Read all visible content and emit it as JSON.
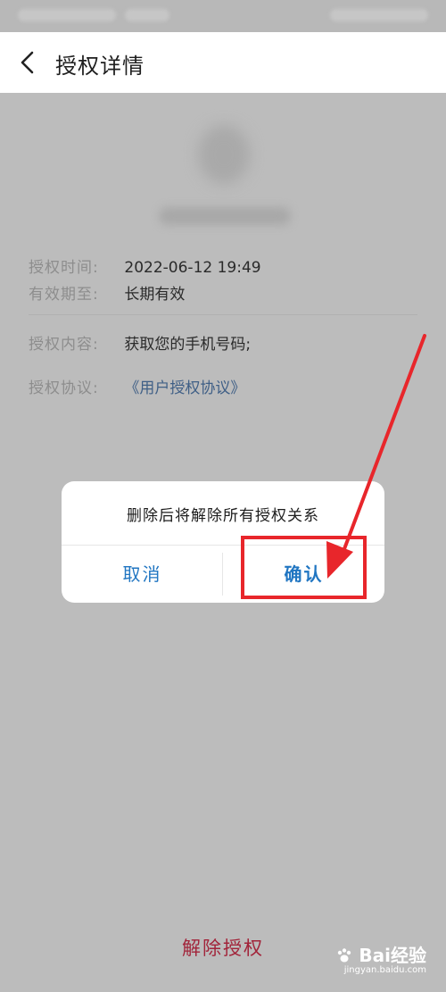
{
  "header": {
    "title": "授权详情"
  },
  "details": {
    "time_label": "授权时间:",
    "time_value": "2022-06-12 19:49",
    "expiry_label": "有效期至:",
    "expiry_value": "长期有效",
    "content_label": "授权内容:",
    "content_value": "获取您的手机号码;",
    "agreement_label": "授权协议:",
    "agreement_value": "《用户授权协议》"
  },
  "footer": {
    "revoke_label": "解除授权"
  },
  "dialog": {
    "message": "删除后将解除所有授权关系",
    "cancel_label": "取消",
    "confirm_label": "确认"
  },
  "watermark": {
    "brand": "Bai经验",
    "url": "jingyan.baidu.com"
  },
  "colors": {
    "link": "#3f5f86",
    "danger": "#a2243a",
    "accent": "#2176c2",
    "annotation": "#e8262b"
  }
}
